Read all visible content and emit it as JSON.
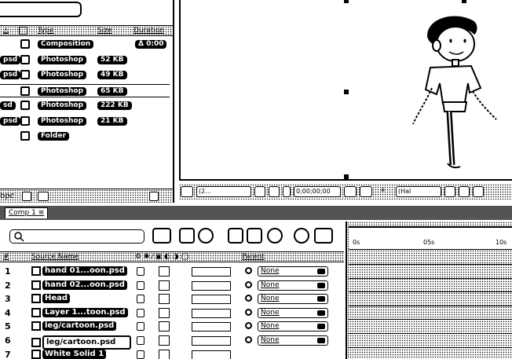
{
  "project": {
    "columns": {
      "type": "Type",
      "size": "Size",
      "duration": "Duration"
    },
    "items": [
      {
        "stub": "",
        "type": "Composition",
        "size": "",
        "duration": "Δ 0:00"
      },
      {
        "stub": "psd",
        "type": "Photoshop",
        "size": "52 KB",
        "duration": ""
      },
      {
        "stub": "psd",
        "type": "Photoshop",
        "size": "49 KB",
        "duration": ""
      },
      {
        "stub": "",
        "type": "Photoshop",
        "size": "65 KB",
        "duration": ""
      },
      {
        "stub": "sd",
        "type": "Photoshop",
        "size": "222 KB",
        "duration": ""
      },
      {
        "stub": "psd",
        "type": "Photoshop",
        "size": "21 KB",
        "duration": ""
      },
      {
        "stub": "",
        "type": "Folder",
        "size": "",
        "duration": ""
      }
    ],
    "footer_bpc": "bpc"
  },
  "viewer": {
    "zoom": "(2...",
    "timecode": "0;00;00;00",
    "view_mode": "(Hal",
    "color_accent": "#000000"
  },
  "timeline": {
    "tab_label": "Comp 1 ≡",
    "columns": {
      "num": "#",
      "source_name": "Source Name",
      "parent": "Parent"
    },
    "ruler_ticks": [
      "0s",
      "05s",
      "10s"
    ],
    "layers": [
      {
        "num": "1",
        "name": "hand 01...oon.psd",
        "parent": "None"
      },
      {
        "num": "2",
        "name": "hand 02...oon.psd",
        "parent": "None"
      },
      {
        "num": "3",
        "name": "Head",
        "parent": "None"
      },
      {
        "num": "4",
        "name": "Layer 1...toon.psd",
        "parent": "None"
      },
      {
        "num": "5",
        "name": "leg/cartoon.psd",
        "parent": "None"
      },
      {
        "num": "6",
        "name": "leg/cartoon.psd",
        "parent": "None"
      },
      {
        "num": "7",
        "name": "White Solid 1",
        "parent": ""
      }
    ]
  }
}
